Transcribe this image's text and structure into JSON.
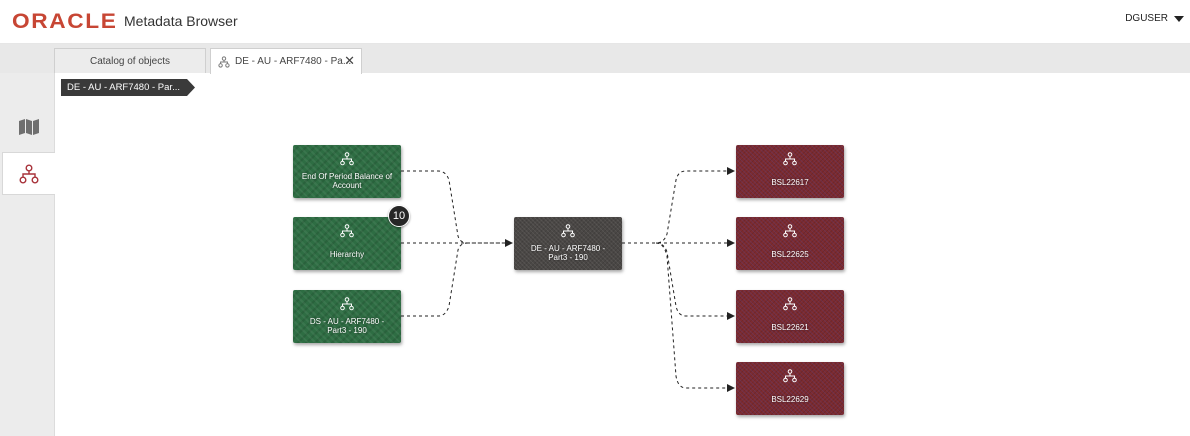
{
  "header": {
    "logo": "ORACLE",
    "title": "Metadata Browser",
    "user": "DGUSER"
  },
  "tabs": [
    {
      "label": "Catalog of objects",
      "active": false
    },
    {
      "label": "DE - AU - ARF7480 - Pa...",
      "active": true
    }
  ],
  "breadcrumb": "DE - AU - ARF7480 - Par...",
  "rail": [
    {
      "icon": "map-icon"
    },
    {
      "icon": "hierarchy-icon",
      "active": true
    }
  ],
  "graph": {
    "sources": [
      {
        "label": "End Of Period Balance of Account",
        "color": "#2e6d43"
      },
      {
        "label": "Hierarchy",
        "color": "#2e6d43",
        "badge": "10"
      },
      {
        "label": "DS - AU - ARF7480 - Part3 - 190",
        "color": "#2e6d43"
      }
    ],
    "center": {
      "label": "DE - AU - ARF7480 - Part3 - 190",
      "color": "#4a4745"
    },
    "targets": [
      {
        "label": "BSL22617",
        "color": "#7d2b2f"
      },
      {
        "label": "BSL22625",
        "color": "#7d2b2f"
      },
      {
        "label": "BSL22621",
        "color": "#7d2b2f"
      },
      {
        "label": "BSL22629",
        "color": "#7d2b2f"
      }
    ]
  }
}
